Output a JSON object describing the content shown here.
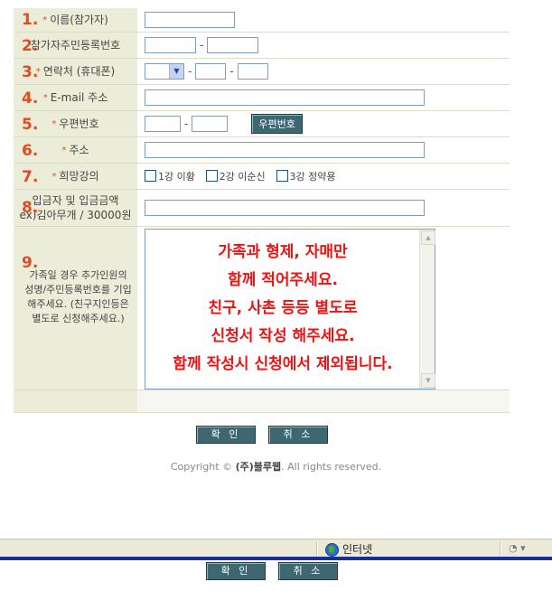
{
  "form": {
    "rows": [
      {
        "num": "1.",
        "label": "이름(참가자)",
        "required": true
      },
      {
        "num": "2.",
        "label": "참가자주민등록번호",
        "required": false
      },
      {
        "num": "3.",
        "label": "연락처 (휴대폰)",
        "required": true
      },
      {
        "num": "4.",
        "label": "E-mail 주소",
        "required": true
      },
      {
        "num": "5.",
        "label": "우편번호",
        "required": true
      },
      {
        "num": "6.",
        "label": "주소",
        "required": true
      },
      {
        "num": "7.",
        "label": "희망강의",
        "required": true
      },
      {
        "num": "8.",
        "label_line1": "입금자 및 입금금액",
        "label_line2": "ex)김아무개 / 30000원"
      },
      {
        "num": "9.",
        "label": "가족일 경우 추가인원의 성명/주민등록번호를 기입해주세요. (친구지인등은 별도로 신청해주세요.)"
      }
    ],
    "dash": "-",
    "zip_button": "우편번호",
    "courses": [
      "1강 이황",
      "2강 이순신",
      "3강 정약용"
    ],
    "textarea_lines": [
      "가족과 형제, 자매만",
      "함께 적어주세요.",
      "친구, 사촌 등등  별도로",
      "신청서 작성 해주세요.",
      "함께 작성시 신청에서 제외됩니다."
    ],
    "star": "*"
  },
  "buttons": {
    "confirm": "확 인",
    "cancel": "취 소"
  },
  "footer": {
    "prefix": "Copyright © ",
    "company": "(주)블루웹",
    "suffix": ". All rights reserved."
  },
  "statusbar": {
    "zone": "인터넷"
  },
  "colors": {
    "label_bg": "#ecedd8",
    "button_bg": "#3d6871",
    "accent": "#e24a1f",
    "notice_red": "#ee1313"
  }
}
